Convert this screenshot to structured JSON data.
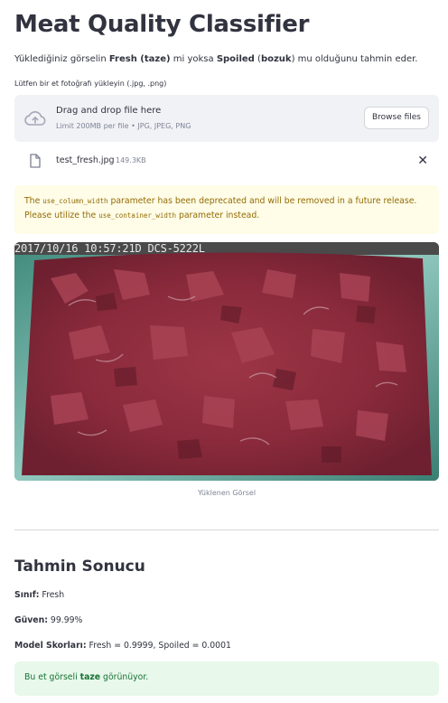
{
  "title": "Meat Quality Classifier",
  "intro": {
    "p1": "Yüklediğiniz görselin ",
    "fresh": "Fresh (taze)",
    "p2": " mi yoksa ",
    "spoiled": "Spoiled",
    "p3": " (",
    "bozuk": "bozuk",
    "p4": ") mu olduğunu tahmin eder."
  },
  "uploader": {
    "label": "Lütfen bir et fotoğrafı yükleyin (.jpg, .png)",
    "drop_title": "Drag and drop file here",
    "limit": "Limit 200MB per file • JPG, JPEG, PNG",
    "browse_label": "Browse files",
    "icon": "cloud-upload-icon"
  },
  "file": {
    "name": "test_fresh.jpg",
    "size": "149.3KB",
    "close": "✕",
    "icon": "file-icon"
  },
  "warning": {
    "t1": "The ",
    "c1": "use_column_width",
    "t2": " parameter has been deprecated and will be removed in a future release. Please utilize the ",
    "c2": "use_container_width",
    "t3": " parameter instead."
  },
  "image": {
    "timestamp": "2017/10/16 10:57:21D DCS-5222L",
    "caption": "Yüklenen Görsel"
  },
  "result": {
    "heading": "Tahmin Sonucu",
    "class_label": "Sınıf:",
    "class_value": " Fresh",
    "conf_label": "Güven:",
    "conf_value": " 99.99%",
    "scores_label": "Model Skorları:",
    "scores_value": " Fresh = 0.9999, Spoiled = 0.0001"
  },
  "success": {
    "t1": "Bu et görseli ",
    "bold": "taze",
    "t2": " görünüyor."
  },
  "colors": {
    "warning_bg": "#fffce7",
    "warning_text": "#926c05",
    "success_bg": "#e8f8eb",
    "success_text": "#177233",
    "dropzone_bg": "#f0f2f6"
  }
}
